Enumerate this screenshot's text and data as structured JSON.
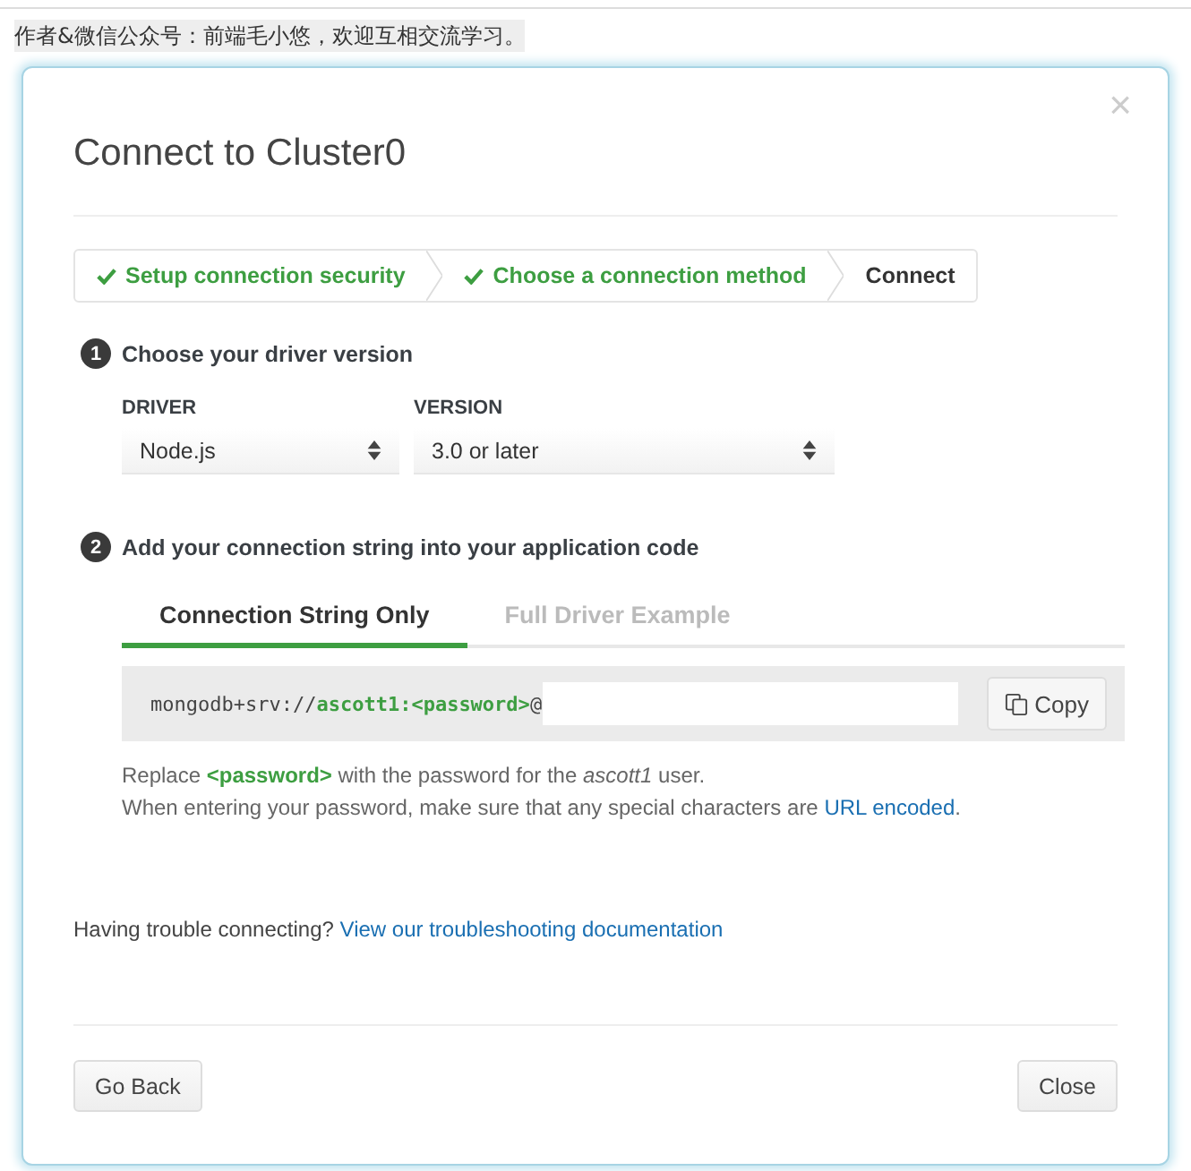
{
  "caption": "作者&微信公众号：前端毛小悠，欢迎互相交流学习。",
  "dialog": {
    "title": "Connect to Cluster0",
    "close": "×",
    "steps": [
      {
        "label": "Setup connection security",
        "done": true
      },
      {
        "label": "Choose a connection method",
        "done": true
      },
      {
        "label": "Connect",
        "done": false
      }
    ],
    "section1": {
      "number": "1",
      "title": "Choose your driver version",
      "selects": [
        {
          "label": "DRIVER",
          "value": "Node.js"
        },
        {
          "label": "VERSION",
          "value": "3.0 or later"
        }
      ]
    },
    "section2": {
      "number": "2",
      "title": "Add your connection string into your application code",
      "tabs": [
        {
          "label": "Connection String Only",
          "selected": true
        },
        {
          "label": "Full Driver Example",
          "selected": false
        }
      ],
      "connection_string": [
        {
          "text": "mongodb+srv://",
          "kind": "plain"
        },
        {
          "text": "ascott1:<password>",
          "kind": "highlight"
        },
        {
          "text": "@",
          "kind": "plain"
        }
      ],
      "copy_button": "Copy",
      "note": "Replace **<password>** with the password for the *ascott1* user.",
      "note2": {
        "text": "When entering your password, make sure that any special characters are",
        "link": "URL encoded",
        "after": "."
      }
    },
    "help": {
      "text": "Having trouble connecting?",
      "link": "View our troubleshooting documentation"
    },
    "buttons": [
      {
        "label": "Go Back"
      },
      {
        "label": "Close"
      }
    ]
  }
}
